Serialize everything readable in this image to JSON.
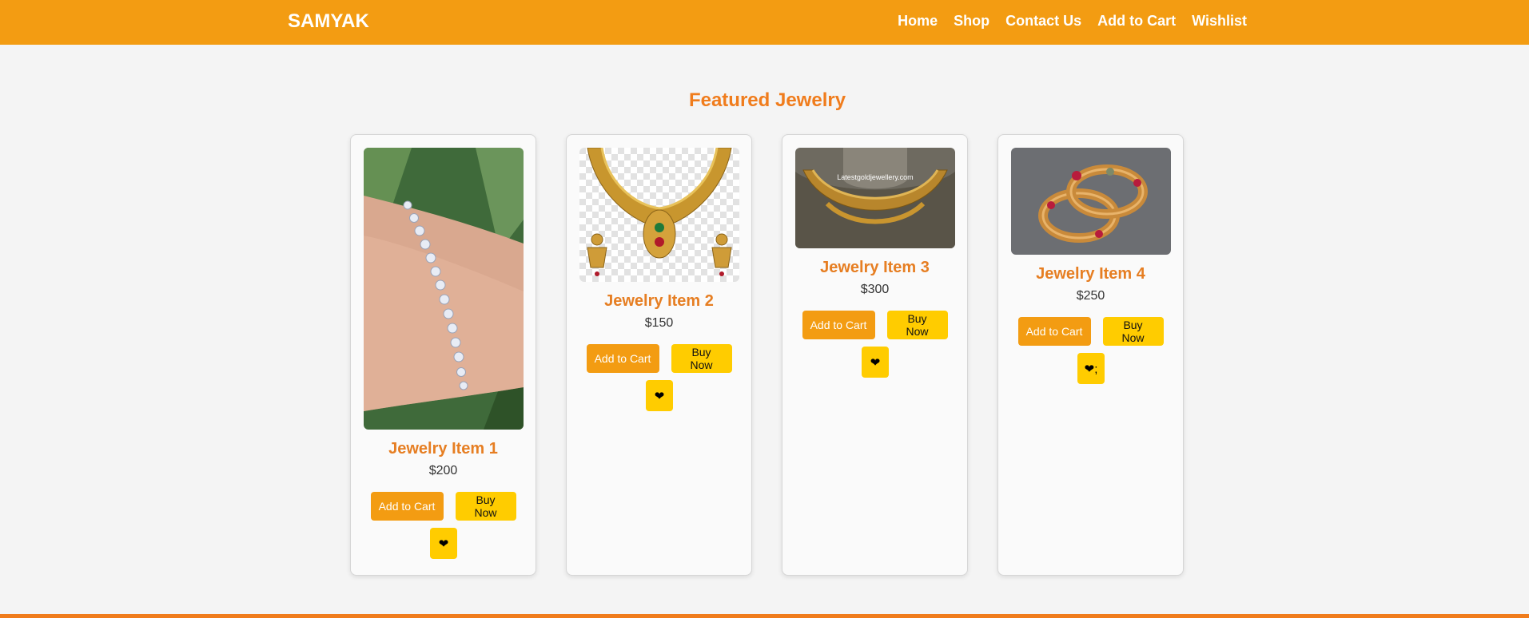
{
  "header": {
    "brand": "SAMYAK",
    "nav": [
      "Home",
      "Shop",
      "Contact Us",
      "Add to Cart",
      "Wishlist"
    ]
  },
  "main": {
    "section_title": "Featured Jewelry",
    "products": [
      {
        "name": "Jewelry Item 1",
        "price": "$200",
        "add_label": "Add to Cart",
        "buy_label": "Buy Now",
        "wish_icon": "❤",
        "image_watermark": ""
      },
      {
        "name": "Jewelry Item 2",
        "price": "$150",
        "add_label": "Add to Cart",
        "buy_label": "Buy Now",
        "wish_icon": "❤",
        "image_watermark": ""
      },
      {
        "name": "Jewelry Item 3",
        "price": "$300",
        "add_label": "Add to Cart",
        "buy_label": "Buy Now",
        "wish_icon": "❤",
        "image_watermark": "Latestgoldjewellery.com"
      },
      {
        "name": "Jewelry Item 4",
        "price": "$250",
        "add_label": "Add to Cart",
        "buy_label": "Buy Now",
        "wish_icon": "❤;",
        "image_watermark": ""
      }
    ]
  },
  "colors": {
    "header_bg": "#f39c12",
    "accent_title": "#f07c1c",
    "add_button": "#f39c12",
    "buy_button": "#ffcc00"
  },
  "icons": {
    "wishlist": "heart-icon"
  }
}
